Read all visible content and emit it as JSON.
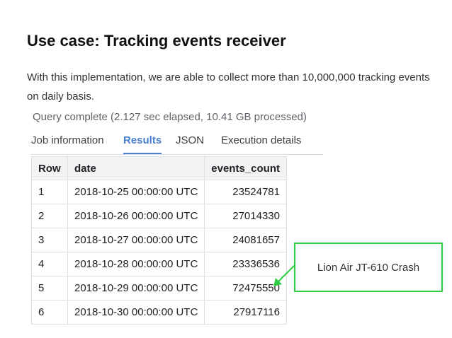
{
  "heading": "Use case: Tracking events receiver",
  "description": "With this implementation, we are able to collect more than 10,000,000 tracking events on daily basis.",
  "query_status": "Query complete (2.127 sec elapsed, 10.41 GB processed)",
  "tabs": [
    {
      "label": "Job information",
      "active": false
    },
    {
      "label": "Results",
      "active": true
    },
    {
      "label": "JSON",
      "active": false
    },
    {
      "label": "Execution details",
      "active": false
    }
  ],
  "table": {
    "columns": [
      "Row",
      "date",
      "events_count"
    ],
    "rows": [
      {
        "row": "1",
        "date": "2018-10-25 00:00:00 UTC",
        "events_count": "23524781"
      },
      {
        "row": "2",
        "date": "2018-10-26 00:00:00 UTC",
        "events_count": "27014330"
      },
      {
        "row": "3",
        "date": "2018-10-27 00:00:00 UTC",
        "events_count": "24081657"
      },
      {
        "row": "4",
        "date": "2018-10-28 00:00:00 UTC",
        "events_count": "23336536"
      },
      {
        "row": "5",
        "date": "2018-10-29 00:00:00 UTC",
        "events_count": "72475550"
      },
      {
        "row": "6",
        "date": "2018-10-30 00:00:00 UTC",
        "events_count": "27917116"
      }
    ]
  },
  "annotation": {
    "text": "Lion Air JT-610 Crash",
    "color": "#2ecc40"
  },
  "colors": {
    "tab_active": "#4a7fcf",
    "header_bg": "#f1f3f4",
    "callout_border": "#2ecc40"
  }
}
